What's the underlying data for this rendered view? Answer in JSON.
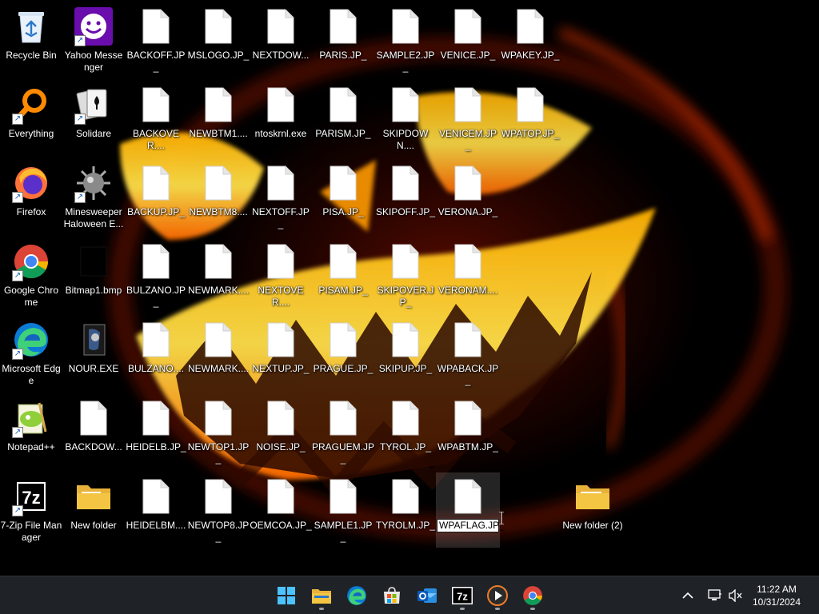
{
  "desktop": {
    "shortcuts": [
      {
        "label": "Recycle Bin",
        "icon": "recycle-bin-icon"
      },
      {
        "label": "Everything",
        "icon": "everything-search-icon"
      },
      {
        "label": "Firefox",
        "icon": "firefox-icon"
      },
      {
        "label": "Google Chrome",
        "icon": "chrome-icon"
      },
      {
        "label": "Microsoft Edge",
        "icon": "edge-icon"
      },
      {
        "label": "Notepad++",
        "icon": "notepadpp-icon"
      },
      {
        "label": "7-Zip File Manager",
        "icon": "sevenzip-icon"
      },
      {
        "label": "Yahoo Messenger",
        "icon": "yahoo-messenger-icon"
      },
      {
        "label": "Solidare",
        "icon": "solitaire-cards-icon"
      },
      {
        "label": "Minesweeper Haloween E...",
        "icon": "minesweeper-mine-icon"
      },
      {
        "label": "Bitmap1.bmp",
        "icon": "bitmap-icon"
      },
      {
        "label": "NOUR.EXE",
        "icon": "exe-app-icon"
      },
      {
        "label": "BACKDOW...",
        "icon": "file-icon"
      },
      {
        "label": "New folder",
        "icon": "folder-icon"
      }
    ],
    "files": [
      [
        "BACKOFF.JP_",
        "MSLOGO.JP_",
        "NEXTDOW...",
        "PARIS.JP_",
        "SAMPLE2.JP_",
        "VENICE.JP_",
        "WPAKEY.JP_"
      ],
      [
        "BACKOVER....",
        "NEWBTM1....",
        "ntoskrnl.exe",
        "PARISM.JP_",
        "SKIPDOWN....",
        "VENICEM.JP_",
        "WPATOP.JP_"
      ],
      [
        "BACKUP.JP_",
        "NEWBTM8....",
        "NEXTOFF.JP_",
        "PISA.JP_",
        "SKIPOFF.JP_",
        "VERONA.JP_"
      ],
      [
        "BULZANO.JP_",
        "NEWMARK....",
        "NEXTOVER....",
        "PISAM.JP_",
        "SKIPOVER.JP_",
        "VERONAM...."
      ],
      [
        "BULZANO....",
        "NEWMARK....",
        "NEXTUP.JP_",
        "PRAGUE.JP_",
        "SKIPUP.JP_",
        "WPABACK.JP_"
      ],
      [
        "HEIDELB.JP_",
        "NEWTOP1.JP_",
        "NOISE.JP_",
        "PRAGUEM.JP_",
        "TYROL.JP_",
        "WPABTM.JP_"
      ],
      [
        "HEIDELBM....",
        "NEWTOP8.JP_",
        "OEMCOA.JP_",
        "SAMPLE1.JP_",
        "TYROLM.JP_"
      ]
    ],
    "renaming": {
      "value": "WPAFLAG.JP_"
    },
    "new_folder_2": {
      "label": "New folder (2)"
    }
  },
  "taskbar": {
    "apps": [
      "start-windows-icon",
      "file-explorer-icon",
      "edge-icon",
      "microsoft-store-icon",
      "outlook-icon",
      "sevenzip-icon",
      "media-player-icon",
      "chrome-icon"
    ],
    "tray": {
      "chevron": "chevron-up-icon",
      "network": "network-icon",
      "volume": "volume-muted-icon",
      "time": "11:22 AM",
      "date": "10/31/2024"
    }
  },
  "colors": {
    "taskbar_bg": "#1f2328",
    "wallpaper_glow": "#ff7a00",
    "wallpaper_core": "#ffd21a",
    "folder_yellow": "#f4c542"
  }
}
